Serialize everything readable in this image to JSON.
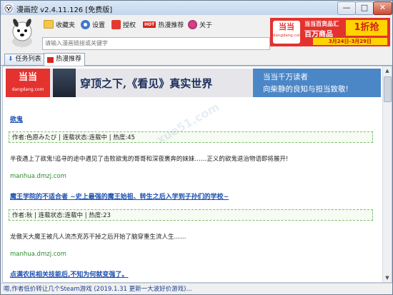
{
  "window": {
    "title": "漫画控 v2.4.11.126 [免费版]",
    "min": "—",
    "max": "□",
    "close": "✕"
  },
  "toolbar": {
    "favorites": "收藏夹",
    "settings": "设置",
    "authorize": "授权",
    "hot_badge": "HOT",
    "hot_recommend": "热漫推荐",
    "about": "关于"
  },
  "search": {
    "placeholder": "请输入漫画链接或关键字"
  },
  "top_banner": {
    "brand": "当当",
    "site": "dangdang.com",
    "headline": "当当百货品汇",
    "sub": "百万商品",
    "deal": "1折抢",
    "dates": "3月24日-3月29日"
  },
  "tabs": [
    {
      "label": "任务列表"
    },
    {
      "label": "热漫推荐"
    }
  ],
  "mid_banner": {
    "brand": "当当",
    "site": "dangdang.com",
    "headline": "穿顶之下,《看见》真实世界",
    "line1": "当当千万读者",
    "line2": "向柴静的良知与担当致敬!"
  },
  "items": [
    {
      "title": "欲鬼",
      "meta": "作者:色原みたび | 连载状态:连载中 | 热度:45",
      "desc": "半夜遇上了欲鬼!追寻的途中遇见了击败欲鬼的哥哥和深夜裹奔的妹妹……正义的欲鬼退治物语即将展开!",
      "source": "manhua.dmzj.com"
    },
    {
      "title": "魔王学院的不适合者 ~史上最强的魔王始祖、转生之后入学到子孙们的学校~",
      "meta": "作者:秋 | 连载状态:连载中 | 热度:23",
      "desc": "龙傲天大魔王被凡人流杰克苏干掉之后开始了脑穿重生流人生……",
      "source": "manhua.dmzj.com"
    },
    {
      "title": "点满农民相关技能后,不知为何就变强了。",
      "meta": "",
      "desc": "",
      "source": ""
    }
  ],
  "status": {
    "text": "嗯,作者低价转让几个Steam游戏 (2019.1.31 更新一大波好价游戏)..."
  },
  "watermark": {
    "text": "xue51.com"
  },
  "colors": {
    "link": "#1a4fb0",
    "source": "#2e8b2e",
    "dang_red": "#e4322f",
    "meta_border": "#7cbf6a"
  }
}
